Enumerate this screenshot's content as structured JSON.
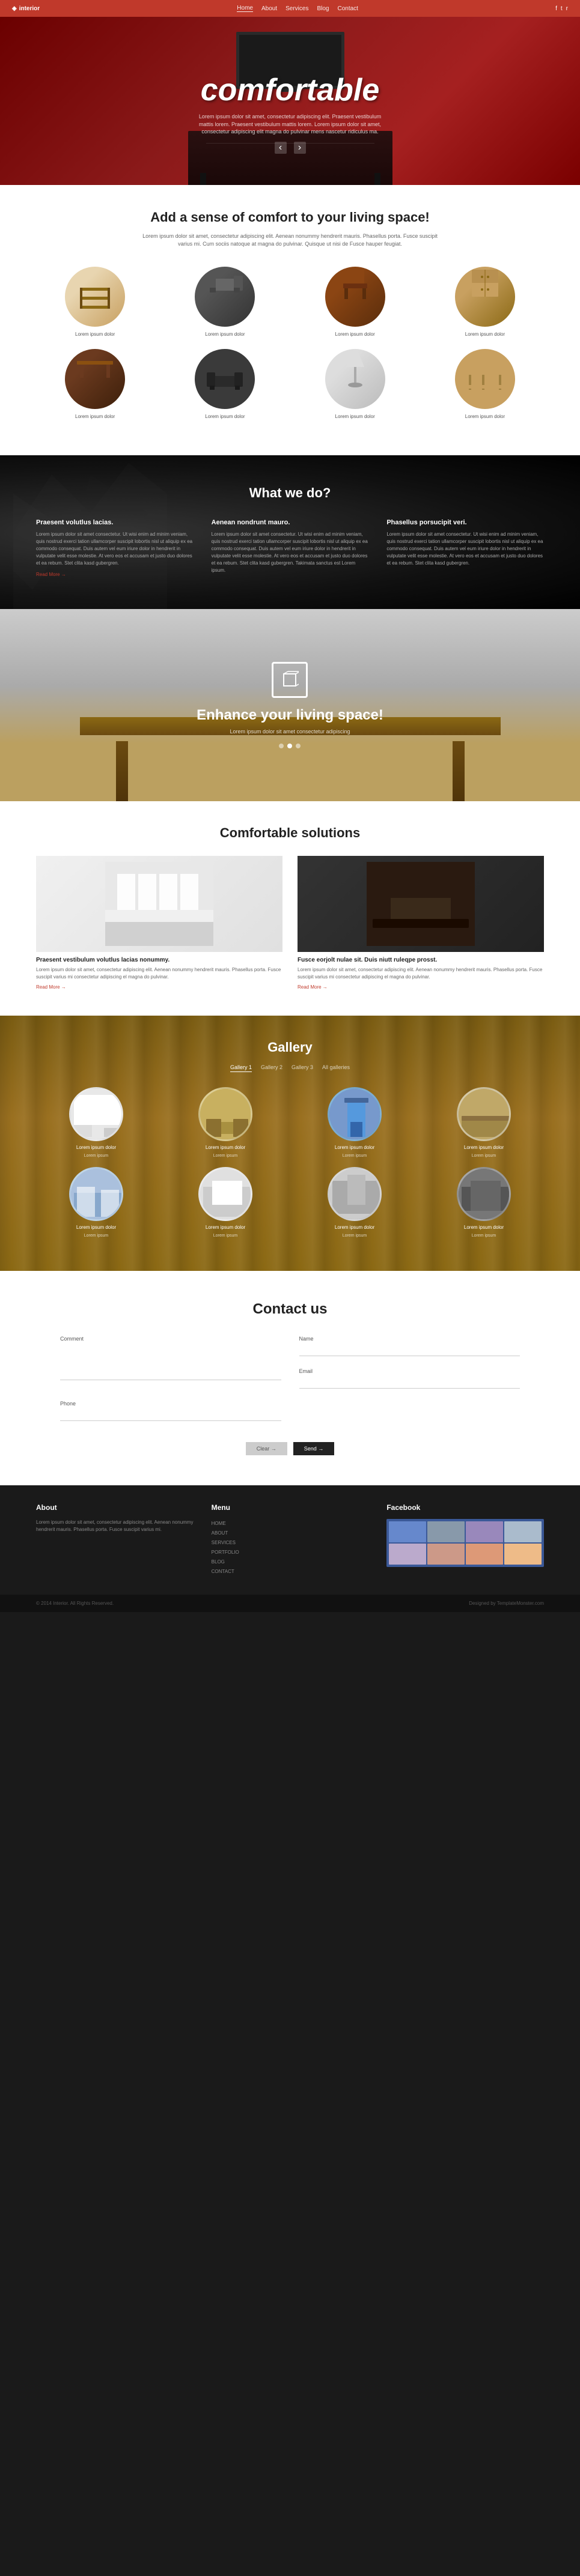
{
  "nav": {
    "logo": "interior",
    "links": [
      "Home",
      "About",
      "Services",
      "Blog",
      "Contact"
    ],
    "active": "Home"
  },
  "hero": {
    "title": "comfortable",
    "text": "Lorem ipsum dolor sit amet, consectetur adipiscing elit. Praesent vestibulum mattis lorem. Praesent vestibulum mattis lorem. Lorem ipsum dolor sit amet, consectetur adipiscing elit magna do pulvinar mens nascetur ridiculus ma.",
    "arrow_left": "‹",
    "arrow_right": "›"
  },
  "comfort": {
    "title": "Add a sense of comfort to your living space!",
    "subtitle": "Lorem ipsum dolor sit amet, consectetur adipiscing elit. Aenean nonummy hendrerit mauris. Phasellus porta. Fusce suscipit varius mi. Cum sociis natoque at magna do pulvinar. Quisque ut nisi de Fusce hauper feugiat.",
    "products": [
      {
        "label": "Lorem ipsum dolor",
        "type": "shelf"
      },
      {
        "label": "Lorem ipsum dolor",
        "type": "sofa"
      },
      {
        "label": "Lorem ipsum dolor",
        "type": "chair"
      },
      {
        "label": "Lorem ipsum dolor",
        "type": "cabinet"
      },
      {
        "label": "Lorem ipsum dolor",
        "type": "table"
      },
      {
        "label": "Lorem ipsum dolor",
        "type": "dark-sofa"
      },
      {
        "label": "Lorem ipsum dolor",
        "type": "lamp"
      },
      {
        "label": "Lorem ipsum dolor",
        "type": "wood"
      }
    ]
  },
  "what_we_do": {
    "title": "What we do?",
    "columns": [
      {
        "heading": "Praesent volutlus lacias.",
        "text": "Lorem ipsum dolor sit amet consectetur. Ut wisi enim ad minim veniam, quis nostrud exerci tation ullamcorper suscipit lobortis nisl ut aliquip ex ea commodo consequat. Duis autem vel eum iriure dolor in hendrerit in vulputate velit esse molestie. At vero eos et accusam et justo duo dolores et ea rebum. Stet clita kasd gubergren.",
        "read_more": "Read More →"
      },
      {
        "heading": "Aenean nondrunt mauro.",
        "text": "Lorem ipsum dolor sit amet consectetur. Ut wisi enim ad minim veniam, quis nostrud exerci tation ullamcorper suscipit lobortis nisl ut aliquip ex ea commodo consequat. Duis autem vel eum iriure dolor in hendrerit in vulputate velit esse molestie. At vero eos et accusam et justo duo dolores et ea rebum. Stet clita kasd gubergren. Takimata sanctus est Lorem ipsum.",
        "read_more": ""
      },
      {
        "heading": "Phasellus porsucipit veri.",
        "text": "Lorem ipsum dolor sit amet consectetur. Ut wisi enim ad minim veniam, quis nostrud exerci tation ullamcorper suscipit lobortis nisl ut aliquip ex ea commodo consequat. Duis autem vel eum iriure dolor in hendrerit in vulputate velit esse molestie. At vero eos et accusam et justo duo dolores et ea rebum. Stet clita kasd gubergren.",
        "read_more": ""
      }
    ]
  },
  "enhance": {
    "title": "Enhance your living space!",
    "subtitle": "Lorem ipsum dolor sit amet consectetur adipiscing",
    "dots": [
      false,
      true,
      false
    ]
  },
  "solutions": {
    "title": "Comfortable solutions",
    "items": [
      {
        "heading": "Praesent vestibulum volutlus lacias nonummy.",
        "text": "Lorem ipsum dolor sit amet, consectetur adipiscing elit. Aenean nonummy hendrerit mauris. Phasellus porta. Fusce suscipit varius mi consectetur adipiscing el magna do pulvinar.",
        "read_more": "Read More →"
      },
      {
        "heading": "Fusce eorjolt nulae sit. Duis niutt ruleqpe prosst.",
        "text": "Lorem ipsum dolor sit amet, consectetur adipiscing elit. Aenean nonummy hendrerit mauris. Phasellus porta. Fusce suscipit varius mi consectetur adipiscing el magna do pulvinar.",
        "read_more": "Read More →"
      }
    ]
  },
  "gallery": {
    "title": "Gallery",
    "tabs": [
      "Gallery 1",
      "Gallery 2",
      "Gallery 3",
      "All galleries"
    ],
    "active_tab": 0,
    "items": [
      {
        "label": "Lorem ipsum dolor",
        "sublabel": "Lorem ipsum",
        "type": "gc1"
      },
      {
        "label": "Lorem ipsum dolor",
        "sublabel": "Lorem ipsum",
        "type": "gc2"
      },
      {
        "label": "Lorem ipsum dolor",
        "sublabel": "Lorem ipsum",
        "type": "gc3"
      },
      {
        "label": "Lorem ipsum dolor",
        "sublabel": "Lorem ipsum",
        "type": "gc4"
      },
      {
        "label": "Lorem ipsum dolor",
        "sublabel": "Lorem ipsum",
        "type": "gc5"
      },
      {
        "label": "Lorem ipsum dolor",
        "sublabel": "Lorem ipsum",
        "type": "gc6"
      },
      {
        "label": "Lorem ipsum dolor",
        "sublabel": "Lorem ipsum",
        "type": "gc7"
      },
      {
        "label": "Lorem ipsum dolor",
        "sublabel": "Lorem ipsum",
        "type": "gc8"
      }
    ]
  },
  "contact": {
    "title": "Contact us",
    "fields": [
      {
        "label": "Name",
        "type": "input",
        "placeholder": ""
      },
      {
        "label": "Comment",
        "type": "textarea",
        "placeholder": ""
      },
      {
        "label": "Email",
        "type": "input",
        "placeholder": ""
      },
      {
        "label": "",
        "type": "spacer",
        "placeholder": ""
      },
      {
        "label": "Phone",
        "type": "input",
        "placeholder": ""
      }
    ],
    "btn_clear": "Clear →",
    "btn_send": "Send →"
  },
  "footer": {
    "about_title": "About",
    "about_text": "Lorem ipsum dolor sit amet, consectetur adipiscing elit. Aenean nonummy hendrerit mauris. Phasellus porta. Fusce suscipit varius mi.",
    "menu_title": "Menu",
    "menu_items": [
      "HOME",
      "ABOUT",
      "SERVICES",
      "PORTFOLIO",
      "BLOG",
      "CONTACT"
    ],
    "facebook_title": "Facebook",
    "copyright": "© 2014 Interior. All Rights Reserved.",
    "designed_by": "Designed by TemplateMonster.com"
  }
}
